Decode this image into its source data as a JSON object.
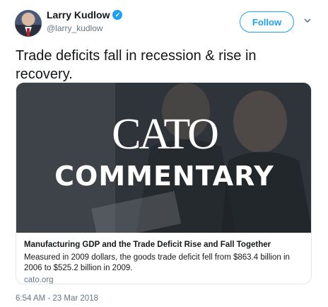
{
  "user": {
    "display_name": "Larry Kudlow",
    "handle": "@larry_kudlow",
    "verified_icon": "verified-badge-icon"
  },
  "actions": {
    "follow_label": "Follow",
    "more_icon": "chevron-down-icon"
  },
  "tweet": {
    "text": "Trade deficits fall in recession & rise in recovery.",
    "timestamp": "6:54 AM - 23 Mar 2018"
  },
  "card": {
    "image_logo_text": "CATO",
    "image_subtitle": "COMMENTARY",
    "title": "Manufacturing GDP and the Trade Deficit Rise and Fall Together",
    "description": "Measured in 2009 dollars, the goods trade deficit fell from $863.4 billion in 2006 to $525.2 billion in 2009.",
    "domain": "cato.org"
  },
  "colors": {
    "accent": "#1da1f2",
    "secondary_text": "#657786",
    "border": "#e1e8ed"
  }
}
